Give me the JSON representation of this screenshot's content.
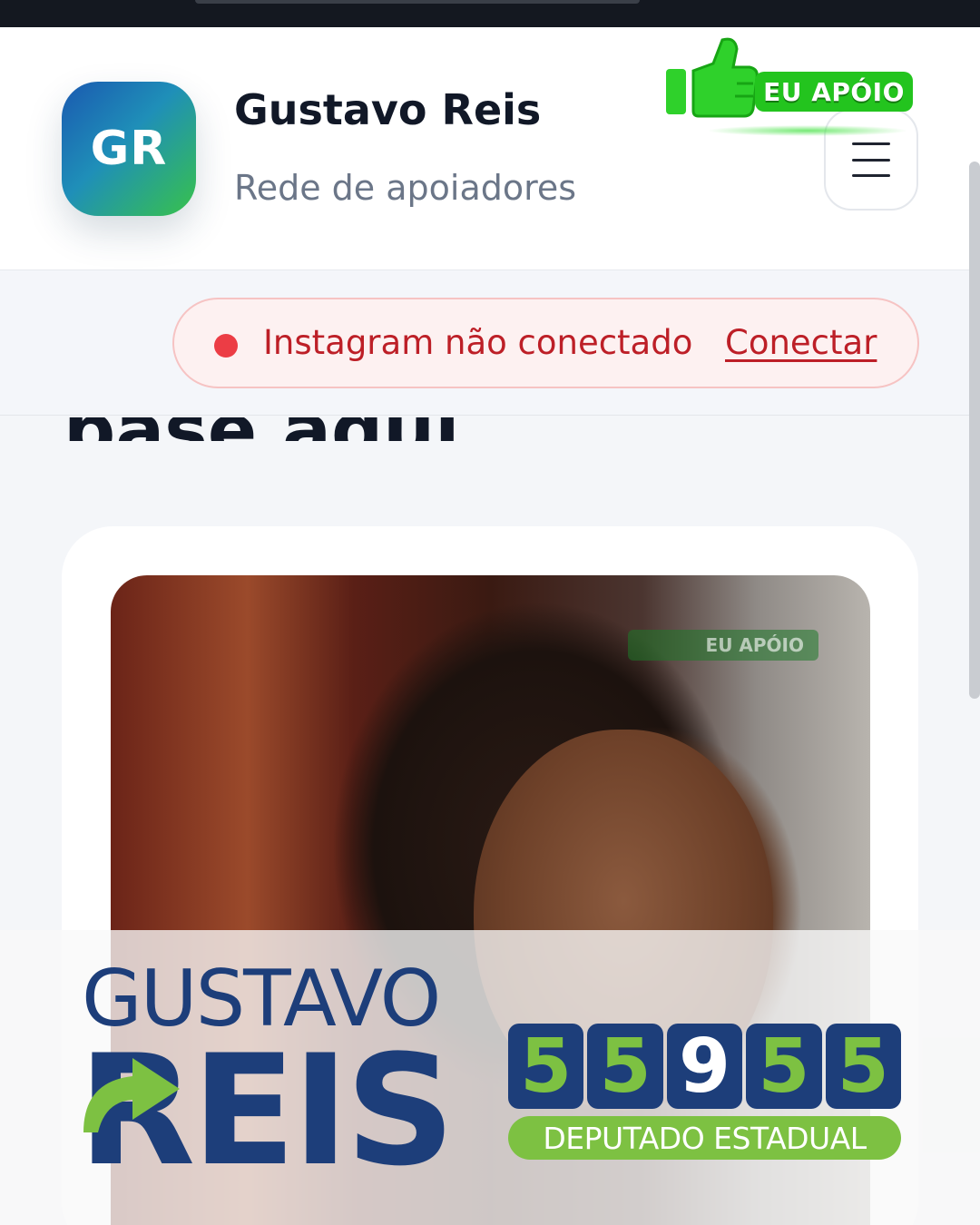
{
  "header": {
    "logo_initials": "GR",
    "title": "Gustavo Reis",
    "subtitle": "Rede de apoiadores",
    "badge_label": "EU APÓIO"
  },
  "alert": {
    "message": "Instagram não conectado",
    "action_label": "Conectar"
  },
  "post": {
    "watermark": "EU APÓIO",
    "candidate_first_name": "GUSTAVO",
    "candidate_last_name": "REIS",
    "ballot_digits": [
      "5",
      "5",
      "9",
      "5",
      "5"
    ],
    "office": "DEPUTADO ESTADUAL"
  },
  "colors": {
    "brand_blue": "#1d3e7a",
    "brand_green": "#7dc142",
    "alert_red": "#bd1f27",
    "badge_green": "#23c41e"
  }
}
